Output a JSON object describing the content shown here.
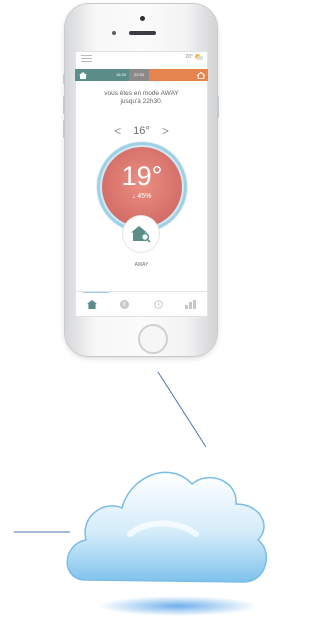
{
  "status_bar": {
    "weather_temp": "20°"
  },
  "schedule_bar": {
    "time_start": "16:30",
    "time_end": "22:30"
  },
  "message": {
    "line1": "vous êtes en mode AWAY",
    "line2": "jusqu'à 22h30."
  },
  "setpoint": {
    "decrease": "<",
    "value": "16°",
    "increase": ">"
  },
  "dial": {
    "temperature": "19°",
    "humidity": "45%",
    "humidity_icon": "drop-icon"
  },
  "mode": {
    "label": "AWAY",
    "icon": "away-house-icon"
  },
  "tabs": [
    {
      "icon": "home-icon",
      "active": true
    },
    {
      "icon": "euro-icon",
      "active": false
    },
    {
      "icon": "clock-icon",
      "active": false
    },
    {
      "icon": "stats-icon",
      "active": false
    }
  ],
  "colors": {
    "teal": "#5b8d89",
    "orange": "#e6844f",
    "dial_red": "#d9756d",
    "ring_blue": "#9fd1e6",
    "cloud_blue": "#6fb8e9"
  }
}
